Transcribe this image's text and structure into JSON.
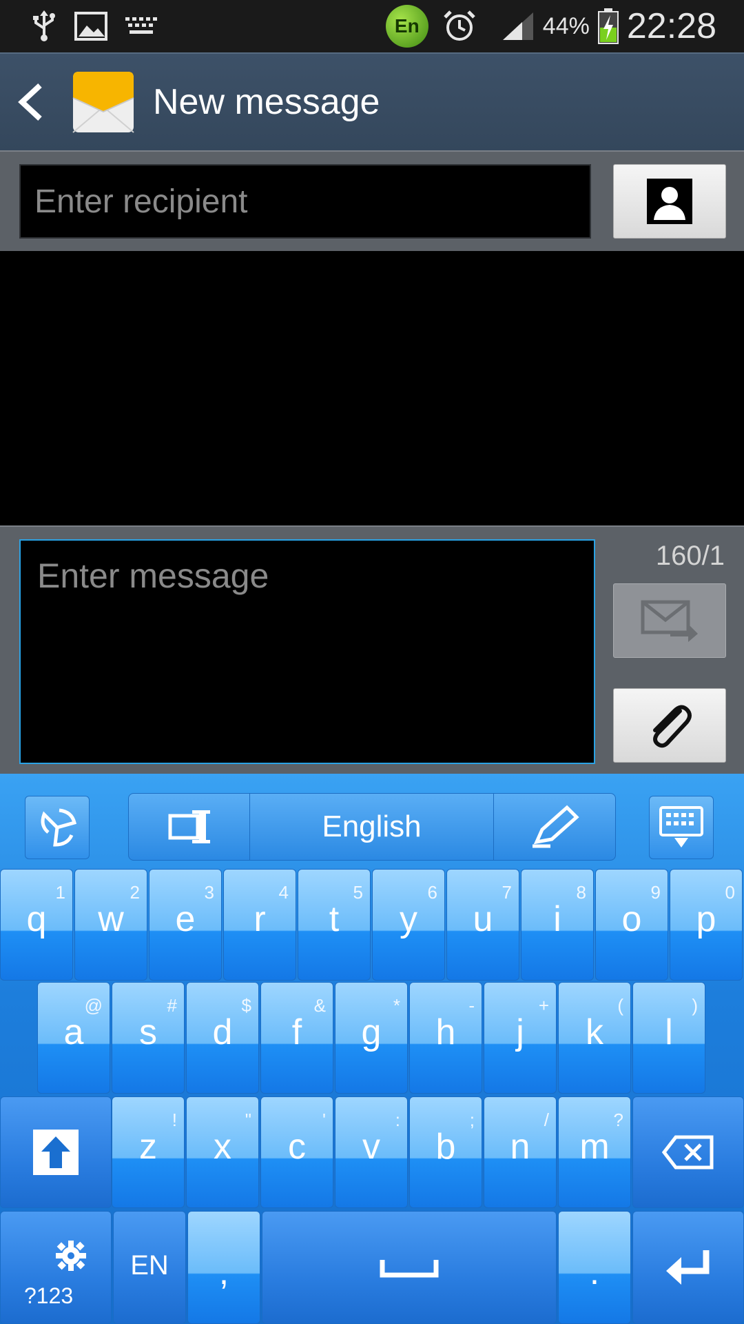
{
  "status_bar": {
    "ime_badge": "En",
    "battery_percent": "44%",
    "time": "22:28",
    "icons": [
      "usb-icon",
      "image-icon",
      "keyboard-icon",
      "alarm-icon",
      "signal-icon",
      "battery-charging-icon"
    ]
  },
  "action_bar": {
    "title": "New message"
  },
  "recipient": {
    "placeholder": "Enter recipient"
  },
  "compose": {
    "placeholder": "Enter message",
    "char_count": "160/1"
  },
  "keyboard": {
    "language": "English",
    "row1": [
      {
        "k": "q",
        "s": "1"
      },
      {
        "k": "w",
        "s": "2"
      },
      {
        "k": "e",
        "s": "3"
      },
      {
        "k": "r",
        "s": "4"
      },
      {
        "k": "t",
        "s": "5"
      },
      {
        "k": "y",
        "s": "6"
      },
      {
        "k": "u",
        "s": "7"
      },
      {
        "k": "i",
        "s": "8"
      },
      {
        "k": "o",
        "s": "9"
      },
      {
        "k": "p",
        "s": "0"
      }
    ],
    "row2": [
      {
        "k": "a",
        "s": "@"
      },
      {
        "k": "s",
        "s": "#"
      },
      {
        "k": "d",
        "s": "$"
      },
      {
        "k": "f",
        "s": "&"
      },
      {
        "k": "g",
        "s": "*"
      },
      {
        "k": "h",
        "s": "-"
      },
      {
        "k": "j",
        "s": "+"
      },
      {
        "k": "k",
        "s": "("
      },
      {
        "k": "l",
        "s": ")"
      }
    ],
    "row3": [
      {
        "k": "z",
        "s": "!"
      },
      {
        "k": "x",
        "s": "\""
      },
      {
        "k": "c",
        "s": "'"
      },
      {
        "k": "v",
        "s": ":"
      },
      {
        "k": "b",
        "s": ";"
      },
      {
        "k": "n",
        "s": "/"
      },
      {
        "k": "m",
        "s": "?"
      }
    ],
    "symbols_label": "?123",
    "lang_key_label": "EN",
    "comma_label": ",",
    "period_label": "."
  }
}
